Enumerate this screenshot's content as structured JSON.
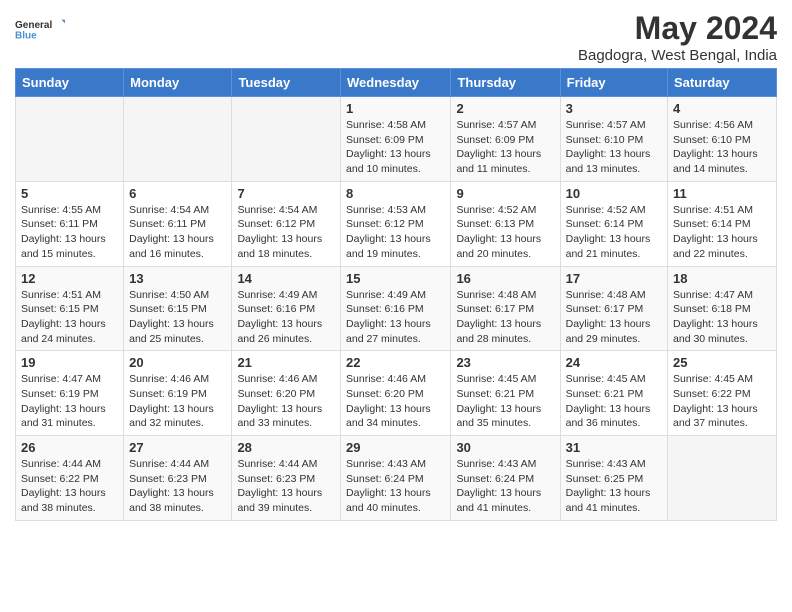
{
  "logo": {
    "line1": "General",
    "line2": "Blue"
  },
  "title": "May 2024",
  "location": "Bagdogra, West Bengal, India",
  "days_of_week": [
    "Sunday",
    "Monday",
    "Tuesday",
    "Wednesday",
    "Thursday",
    "Friday",
    "Saturday"
  ],
  "weeks": [
    [
      {
        "day": "",
        "info": ""
      },
      {
        "day": "",
        "info": ""
      },
      {
        "day": "",
        "info": ""
      },
      {
        "day": "1",
        "info": "Sunrise: 4:58 AM\nSunset: 6:09 PM\nDaylight: 13 hours\nand 10 minutes."
      },
      {
        "day": "2",
        "info": "Sunrise: 4:57 AM\nSunset: 6:09 PM\nDaylight: 13 hours\nand 11 minutes."
      },
      {
        "day": "3",
        "info": "Sunrise: 4:57 AM\nSunset: 6:10 PM\nDaylight: 13 hours\nand 13 minutes."
      },
      {
        "day": "4",
        "info": "Sunrise: 4:56 AM\nSunset: 6:10 PM\nDaylight: 13 hours\nand 14 minutes."
      }
    ],
    [
      {
        "day": "5",
        "info": "Sunrise: 4:55 AM\nSunset: 6:11 PM\nDaylight: 13 hours\nand 15 minutes."
      },
      {
        "day": "6",
        "info": "Sunrise: 4:54 AM\nSunset: 6:11 PM\nDaylight: 13 hours\nand 16 minutes."
      },
      {
        "day": "7",
        "info": "Sunrise: 4:54 AM\nSunset: 6:12 PM\nDaylight: 13 hours\nand 18 minutes."
      },
      {
        "day": "8",
        "info": "Sunrise: 4:53 AM\nSunset: 6:12 PM\nDaylight: 13 hours\nand 19 minutes."
      },
      {
        "day": "9",
        "info": "Sunrise: 4:52 AM\nSunset: 6:13 PM\nDaylight: 13 hours\nand 20 minutes."
      },
      {
        "day": "10",
        "info": "Sunrise: 4:52 AM\nSunset: 6:14 PM\nDaylight: 13 hours\nand 21 minutes."
      },
      {
        "day": "11",
        "info": "Sunrise: 4:51 AM\nSunset: 6:14 PM\nDaylight: 13 hours\nand 22 minutes."
      }
    ],
    [
      {
        "day": "12",
        "info": "Sunrise: 4:51 AM\nSunset: 6:15 PM\nDaylight: 13 hours\nand 24 minutes."
      },
      {
        "day": "13",
        "info": "Sunrise: 4:50 AM\nSunset: 6:15 PM\nDaylight: 13 hours\nand 25 minutes."
      },
      {
        "day": "14",
        "info": "Sunrise: 4:49 AM\nSunset: 6:16 PM\nDaylight: 13 hours\nand 26 minutes."
      },
      {
        "day": "15",
        "info": "Sunrise: 4:49 AM\nSunset: 6:16 PM\nDaylight: 13 hours\nand 27 minutes."
      },
      {
        "day": "16",
        "info": "Sunrise: 4:48 AM\nSunset: 6:17 PM\nDaylight: 13 hours\nand 28 minutes."
      },
      {
        "day": "17",
        "info": "Sunrise: 4:48 AM\nSunset: 6:17 PM\nDaylight: 13 hours\nand 29 minutes."
      },
      {
        "day": "18",
        "info": "Sunrise: 4:47 AM\nSunset: 6:18 PM\nDaylight: 13 hours\nand 30 minutes."
      }
    ],
    [
      {
        "day": "19",
        "info": "Sunrise: 4:47 AM\nSunset: 6:19 PM\nDaylight: 13 hours\nand 31 minutes."
      },
      {
        "day": "20",
        "info": "Sunrise: 4:46 AM\nSunset: 6:19 PM\nDaylight: 13 hours\nand 32 minutes."
      },
      {
        "day": "21",
        "info": "Sunrise: 4:46 AM\nSunset: 6:20 PM\nDaylight: 13 hours\nand 33 minutes."
      },
      {
        "day": "22",
        "info": "Sunrise: 4:46 AM\nSunset: 6:20 PM\nDaylight: 13 hours\nand 34 minutes."
      },
      {
        "day": "23",
        "info": "Sunrise: 4:45 AM\nSunset: 6:21 PM\nDaylight: 13 hours\nand 35 minutes."
      },
      {
        "day": "24",
        "info": "Sunrise: 4:45 AM\nSunset: 6:21 PM\nDaylight: 13 hours\nand 36 minutes."
      },
      {
        "day": "25",
        "info": "Sunrise: 4:45 AM\nSunset: 6:22 PM\nDaylight: 13 hours\nand 37 minutes."
      }
    ],
    [
      {
        "day": "26",
        "info": "Sunrise: 4:44 AM\nSunset: 6:22 PM\nDaylight: 13 hours\nand 38 minutes."
      },
      {
        "day": "27",
        "info": "Sunrise: 4:44 AM\nSunset: 6:23 PM\nDaylight: 13 hours\nand 38 minutes."
      },
      {
        "day": "28",
        "info": "Sunrise: 4:44 AM\nSunset: 6:23 PM\nDaylight: 13 hours\nand 39 minutes."
      },
      {
        "day": "29",
        "info": "Sunrise: 4:43 AM\nSunset: 6:24 PM\nDaylight: 13 hours\nand 40 minutes."
      },
      {
        "day": "30",
        "info": "Sunrise: 4:43 AM\nSunset: 6:24 PM\nDaylight: 13 hours\nand 41 minutes."
      },
      {
        "day": "31",
        "info": "Sunrise: 4:43 AM\nSunset: 6:25 PM\nDaylight: 13 hours\nand 41 minutes."
      },
      {
        "day": "",
        "info": ""
      }
    ]
  ]
}
